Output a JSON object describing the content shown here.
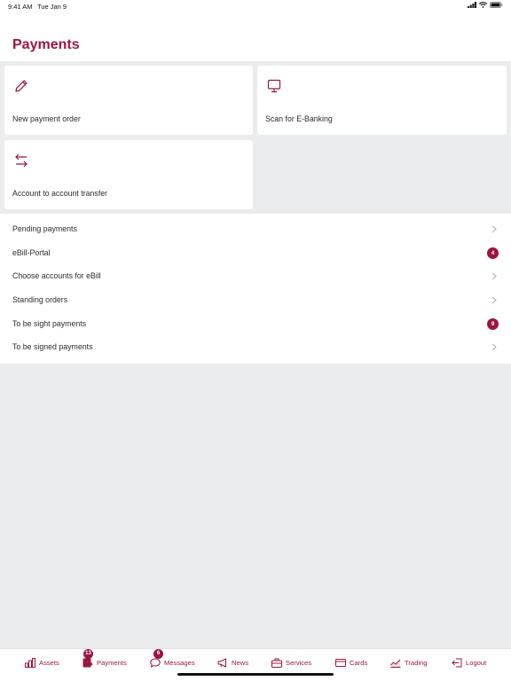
{
  "status_bar": {
    "time": "9:41 AM",
    "date": "Tue Jan 9"
  },
  "header": {
    "title": "Payments"
  },
  "tiles": [
    {
      "label": "New payment order",
      "icon": "pencil-icon"
    },
    {
      "label": "Scan for E-Banking",
      "icon": "monitor-icon"
    },
    {
      "label": "Account to account transfer",
      "icon": "transfer-arrows-icon"
    }
  ],
  "list": [
    {
      "label": "Pending payments",
      "trailing": "chevron"
    },
    {
      "label": "eBill-Portal",
      "trailing": "badge",
      "badge": "4"
    },
    {
      "label": "Choose accounts for eBill",
      "trailing": "chevron"
    },
    {
      "label": "Standing orders",
      "trailing": "chevron"
    },
    {
      "label": "To be sight payments",
      "trailing": "badge",
      "badge": "9"
    },
    {
      "label": "To be signed payments",
      "trailing": "chevron"
    }
  ],
  "tabbar": {
    "items": [
      {
        "label": "Assets",
        "icon": "bar-chart-icon"
      },
      {
        "label": "Payments",
        "icon": "payments-icon",
        "badge": "13"
      },
      {
        "label": "Messages",
        "icon": "chat-bubble-icon",
        "badge": "6"
      },
      {
        "label": "News",
        "icon": "megaphone-icon"
      },
      {
        "label": "Services",
        "icon": "briefcase-icon"
      },
      {
        "label": "Cards",
        "icon": "credit-card-icon"
      },
      {
        "label": "Trading",
        "icon": "trading-chart-icon"
      },
      {
        "label": "Logout",
        "icon": "logout-icon"
      }
    ]
  },
  "colors": {
    "accent": "#9c1444",
    "background": "#ebecee",
    "surface": "#ffffff",
    "text": "#2c2c2c"
  }
}
